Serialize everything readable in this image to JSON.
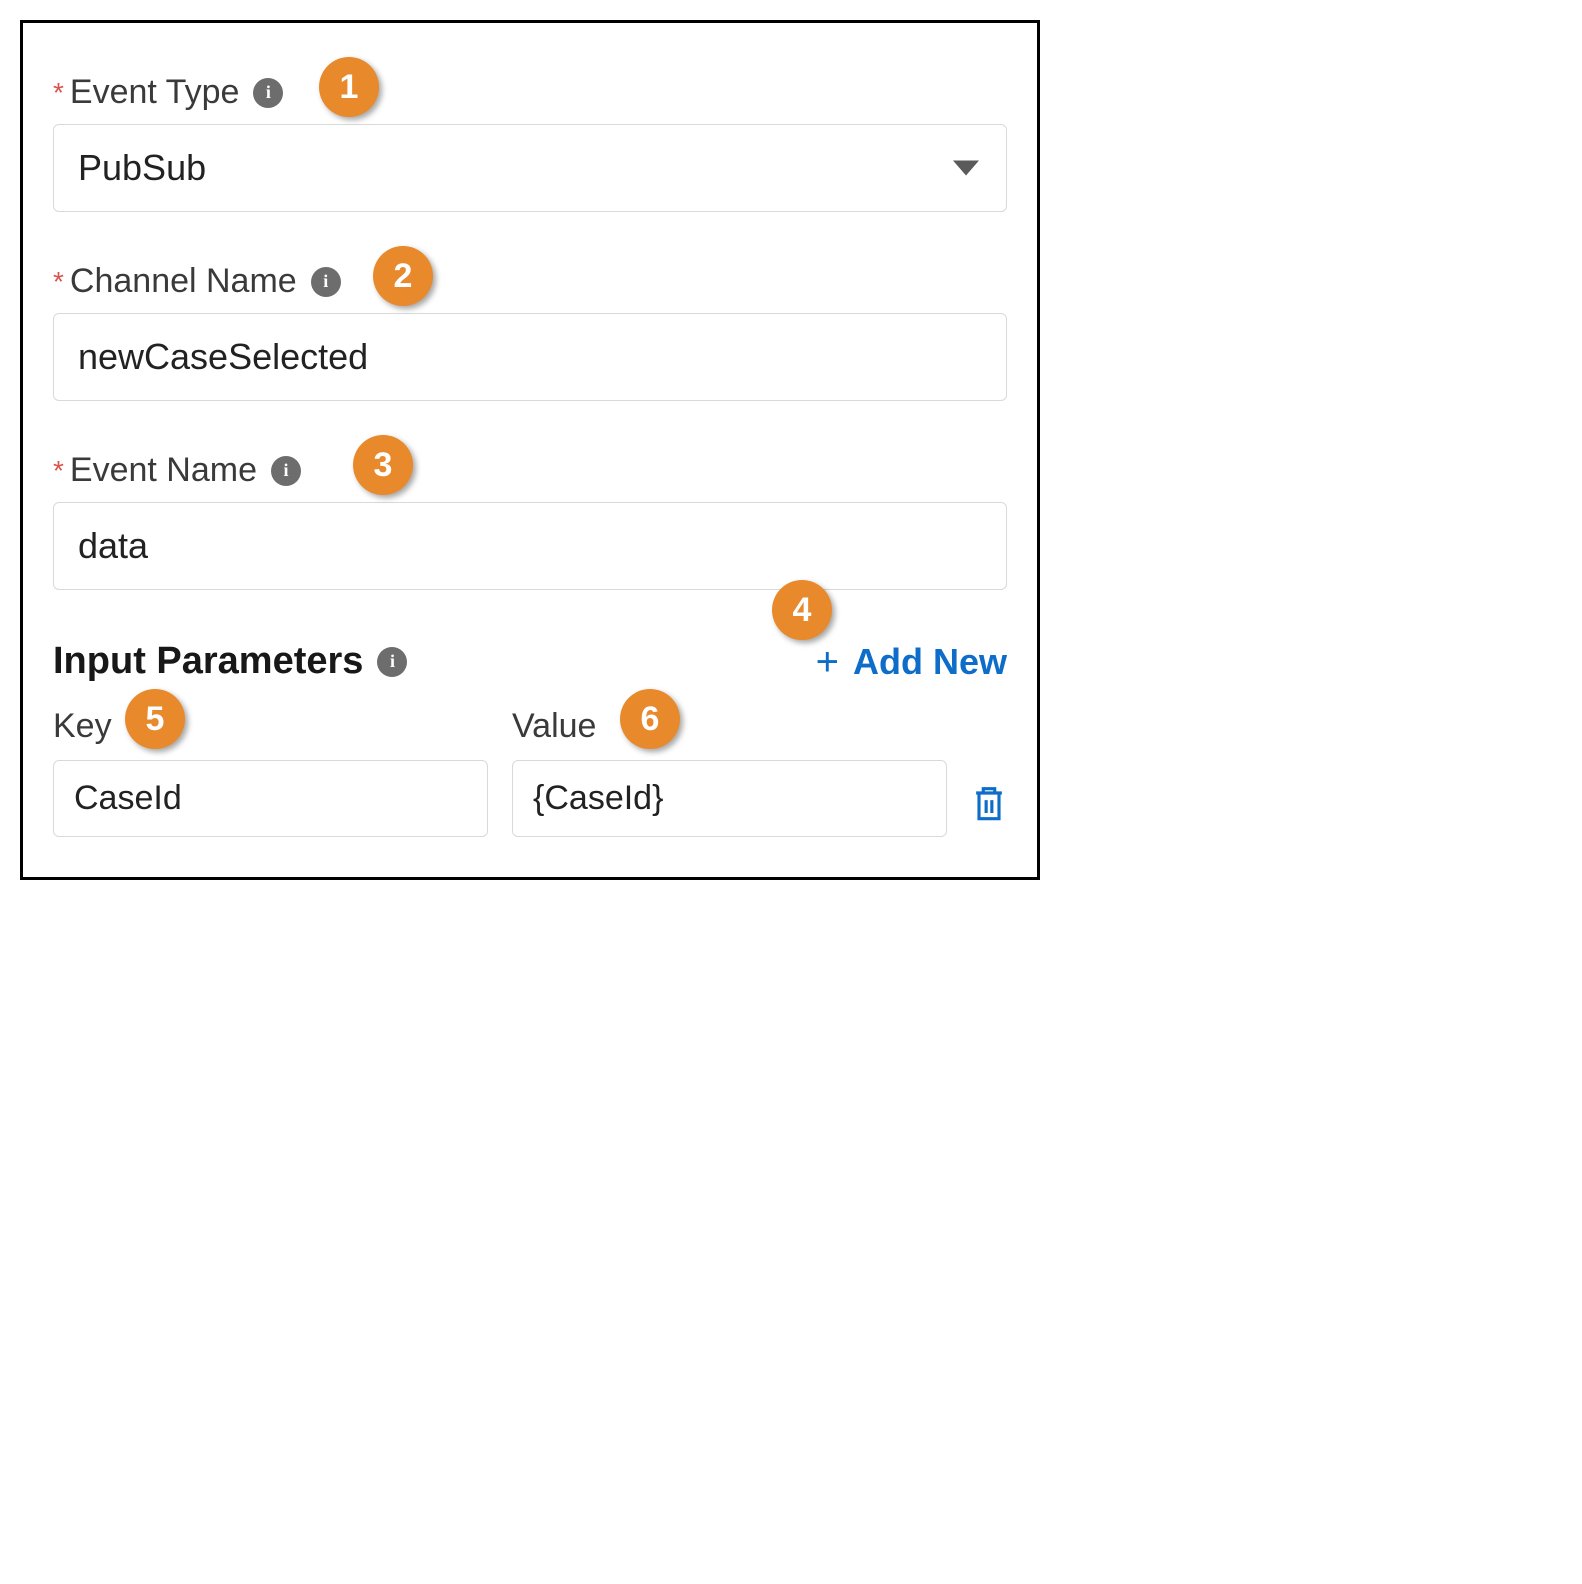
{
  "fields": {
    "eventType": {
      "label": "Event Type",
      "value": "PubSub",
      "required": true
    },
    "channelName": {
      "label": "Channel Name",
      "value": "newCaseSelected",
      "required": true
    },
    "eventName": {
      "label": "Event Name",
      "value": "data",
      "required": true
    }
  },
  "inputParams": {
    "title": "Input Parameters",
    "addNewLabel": "Add New",
    "keyLabel": "Key",
    "valueLabel": "Value",
    "rows": [
      {
        "key": "CaseId",
        "value": "{CaseId}"
      }
    ]
  },
  "callouts": {
    "c1": "1",
    "c2": "2",
    "c3": "3",
    "c4": "4",
    "c5": "5",
    "c6": "6"
  }
}
